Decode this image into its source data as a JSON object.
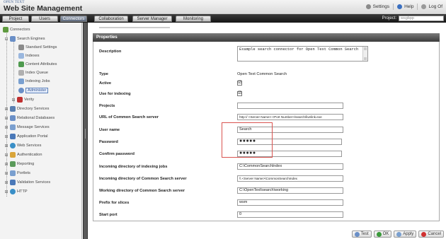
{
  "brand": {
    "small": "OPEN TEXT",
    "title": "Web Site Management"
  },
  "header_links": [
    {
      "label": "Settings",
      "icon": "settings-icon",
      "color": "#7a7a7a"
    },
    {
      "label": "Help",
      "icon": "help-icon",
      "color": "#3a6fc0"
    },
    {
      "label": "Log Of",
      "icon": "logoff-icon",
      "color": "#888888"
    }
  ],
  "tabs": [
    "Project",
    "Users",
    "Connectors",
    "Collaboration",
    "Server Manager",
    "Monitoring"
  ],
  "active_tab": "Connectors",
  "project": {
    "label": "Project:",
    "value": "wsgbpp"
  },
  "tree": [
    {
      "label": "Connectors",
      "icon": "connectors-icon"
    },
    {
      "label": "Search Engines",
      "icon": "search-engines-icon"
    },
    {
      "label": "Standard Settings",
      "icon": "settings-icon"
    },
    {
      "label": "Indexes",
      "icon": "index-icon"
    },
    {
      "label": "Content Attributes",
      "icon": "attributes-icon"
    },
    {
      "label": "Index Queue",
      "icon": "queue-icon"
    },
    {
      "label": "Indexing Jobs",
      "icon": "jobs-icon"
    },
    {
      "label": "Administer",
      "icon": "administer-icon"
    },
    {
      "label": "Verity",
      "icon": "verity-icon"
    },
    {
      "label": "Directory Services",
      "icon": "directory-icon"
    },
    {
      "label": "Relational Databases",
      "icon": "database-icon"
    },
    {
      "label": "Message Services",
      "icon": "message-icon"
    },
    {
      "label": "Application Portal",
      "icon": "portal-icon"
    },
    {
      "label": "Web Services",
      "icon": "web-services-icon"
    },
    {
      "label": "Authentication",
      "icon": "authentication-icon"
    },
    {
      "label": "Reporting",
      "icon": "reporting-icon"
    },
    {
      "label": "Portlets",
      "icon": "portlets-icon"
    },
    {
      "label": "Validation Services",
      "icon": "validation-icon"
    },
    {
      "label": "HTTP",
      "icon": "http-icon"
    }
  ],
  "panel": {
    "title": "Properties",
    "description": {
      "label": "Description",
      "value": "Example search connector for Open Text Common Search"
    },
    "type": {
      "label": "Type",
      "value": "Open Text Common Search"
    },
    "active": {
      "label": "Active",
      "checked": "☑"
    },
    "use_for_indexing": {
      "label": "Use for indexing",
      "checked": "☑"
    },
    "projects": {
      "label": "Projects",
      "value": ""
    },
    "url": {
      "label": "URL of Common Search server",
      "value": "http:// <Server Name>:<Port Number>/search/livelink.exe"
    },
    "user_name": {
      "label": "User name",
      "value": "Search"
    },
    "password": {
      "label": "Password",
      "value": "●●●●●"
    },
    "confirm_password": {
      "label": "Confirm password",
      "value": "●●●●●"
    },
    "incoming_jobs": {
      "label": "Incoming directory of indexing jobs",
      "value": "C:\\CommonSearchIndex"
    },
    "incoming_cs": {
      "label": "Incoming directory of Common Search server",
      "value": "\\\\ <Server Name>\\CommonSearchIndex"
    },
    "working_dir": {
      "label": "Working directory of Common Search server",
      "value": "C:\\OpenText\\search\\working"
    },
    "prefix": {
      "label": "Prefix for slices",
      "value": "wsm"
    },
    "start_port": {
      "label": "Start port",
      "value": "0"
    }
  },
  "buttons": [
    {
      "label": "Test",
      "icon": "test-icon",
      "color": "#6a8fc7"
    },
    {
      "label": "OK",
      "icon": "ok-icon",
      "color": "#3a9a3a"
    },
    {
      "label": "Apply",
      "icon": "apply-icon",
      "color": "#7aa0d0"
    },
    {
      "label": "Cancel",
      "icon": "cancel-icon",
      "color": "#d03030"
    }
  ]
}
